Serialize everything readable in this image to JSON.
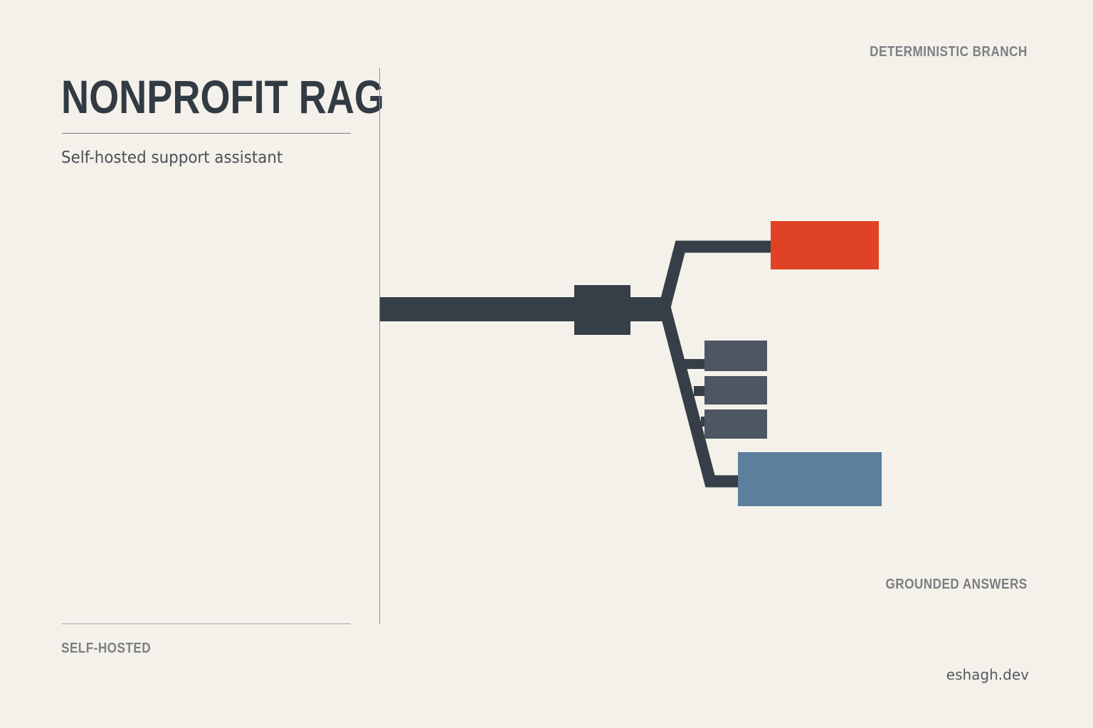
{
  "title": "NONPROFIT RAG",
  "subtitle": "Self-hosted support assistant",
  "labels": {
    "top_right": "DETERMINISTIC BRANCH",
    "bottom_right": "GROUNDED ANSWERS",
    "bottom_left": "SELF-HOSTED",
    "site": "eshagh.dev"
  },
  "colors": {
    "background": "#f4f1eb",
    "ink": "#363e47",
    "accent_red": "#e04225",
    "accent_blue": "#5b7f9c",
    "block_gray": "#4d5662"
  }
}
